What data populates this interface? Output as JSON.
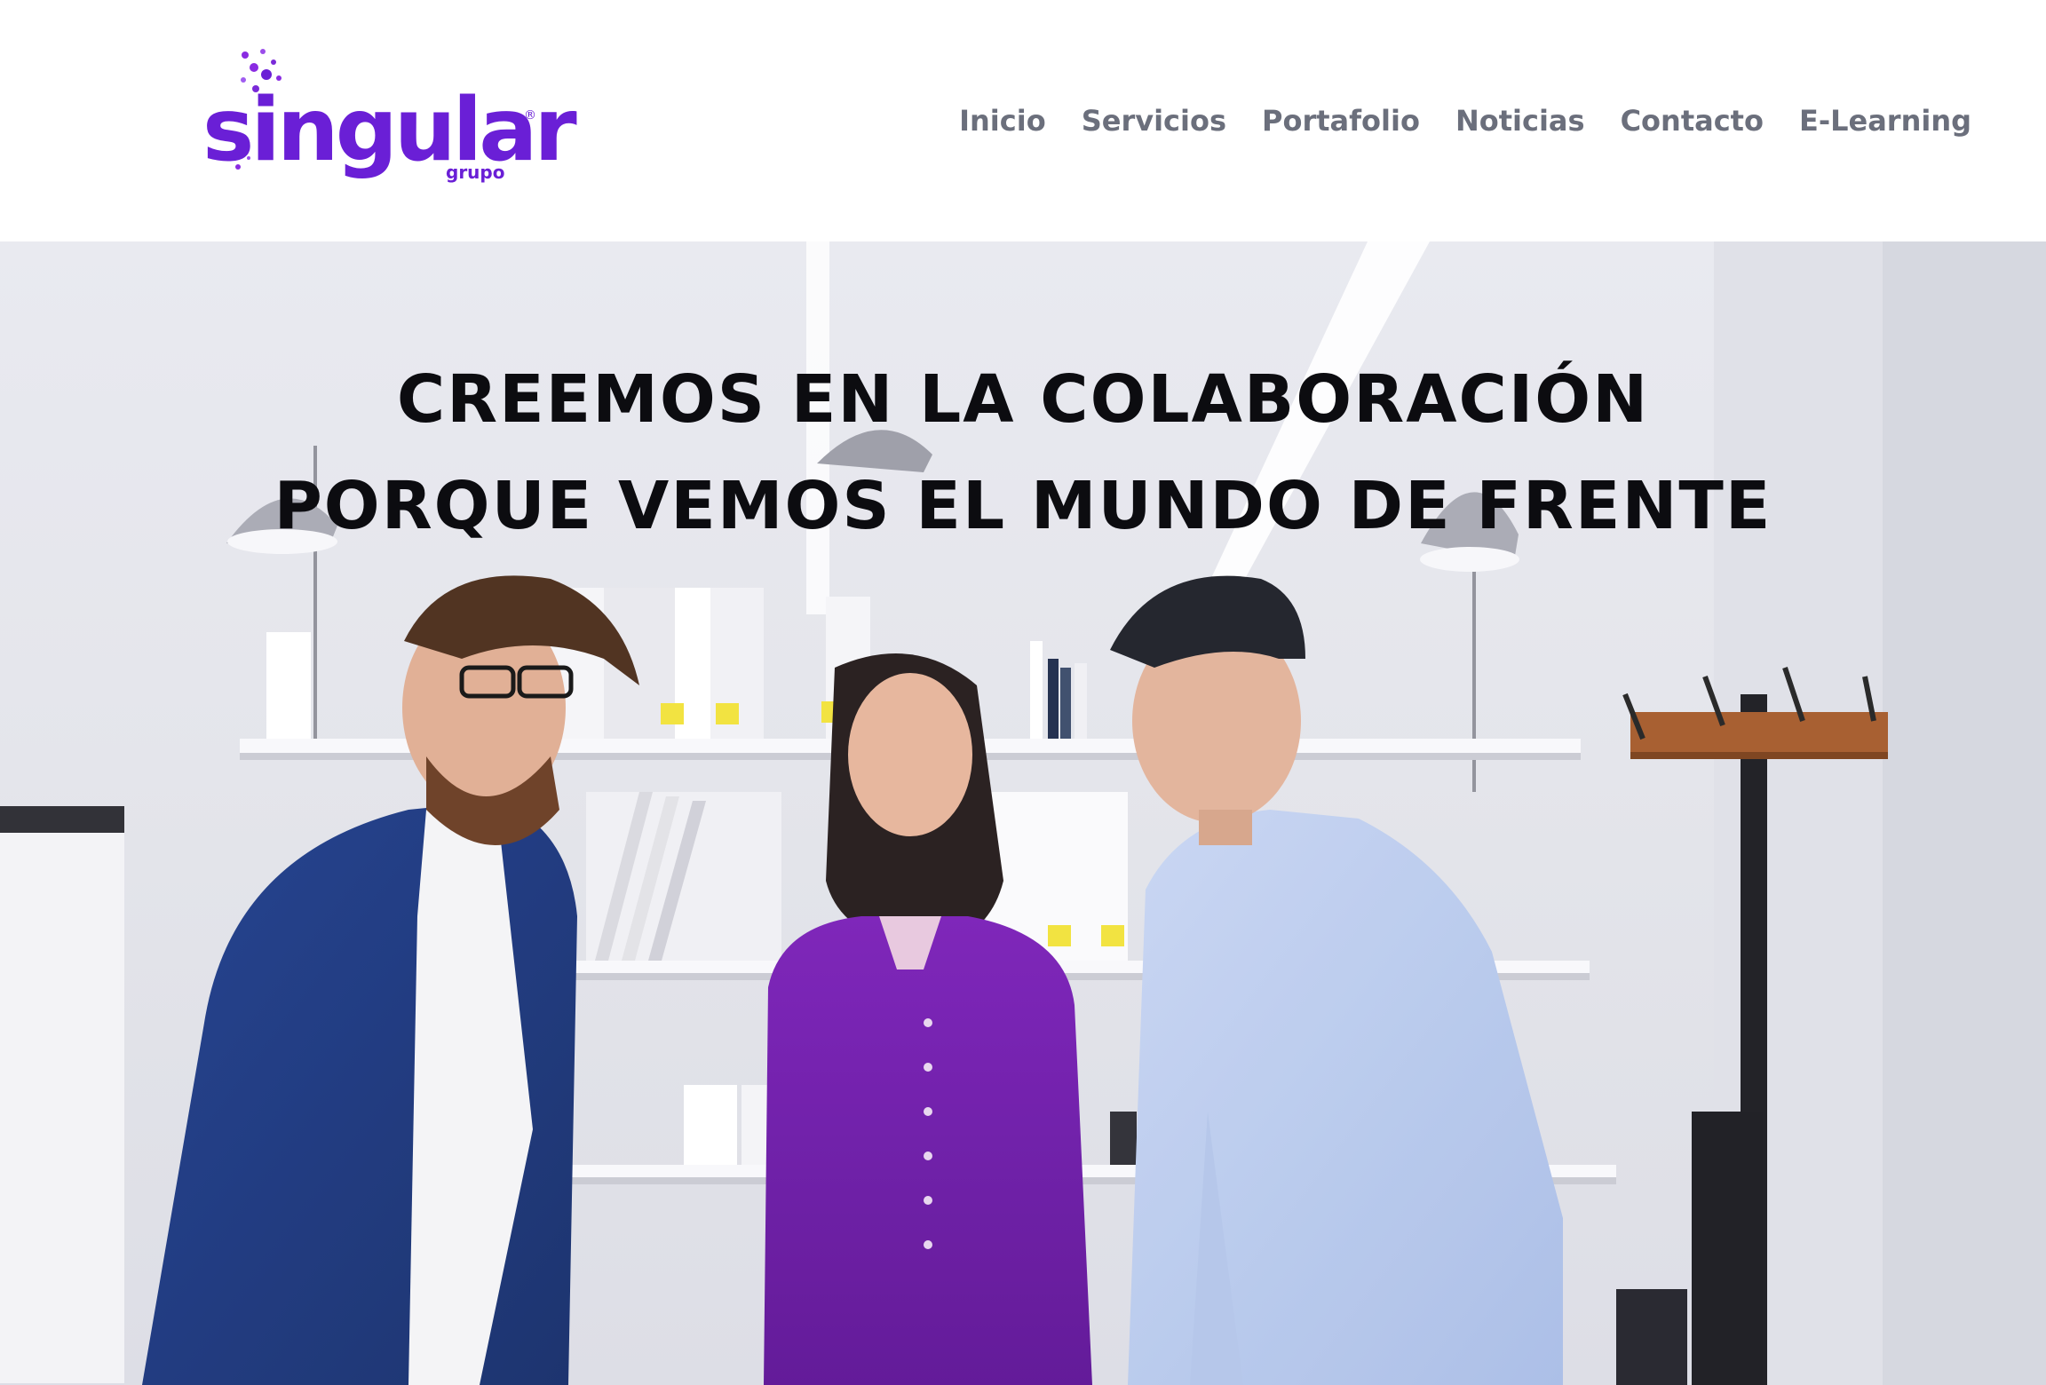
{
  "brand": {
    "name": "singular",
    "subtitle": "grupo",
    "registered_mark": "®",
    "color": "#6a1fd6"
  },
  "nav": {
    "items": [
      {
        "label": "Inicio"
      },
      {
        "label": "Servicios"
      },
      {
        "label": "Portafolio"
      },
      {
        "label": "Noticias"
      },
      {
        "label": "Contacto"
      },
      {
        "label": "E-Learning"
      }
    ],
    "color": "#6b6f7c"
  },
  "hero": {
    "headline_line1": "CREEMOS EN LA COLABORACIÓN",
    "headline_line2": "PORQUE VEMOS EL MUNDO DE FRENTE",
    "image": "office-team-collaboration-photo"
  }
}
